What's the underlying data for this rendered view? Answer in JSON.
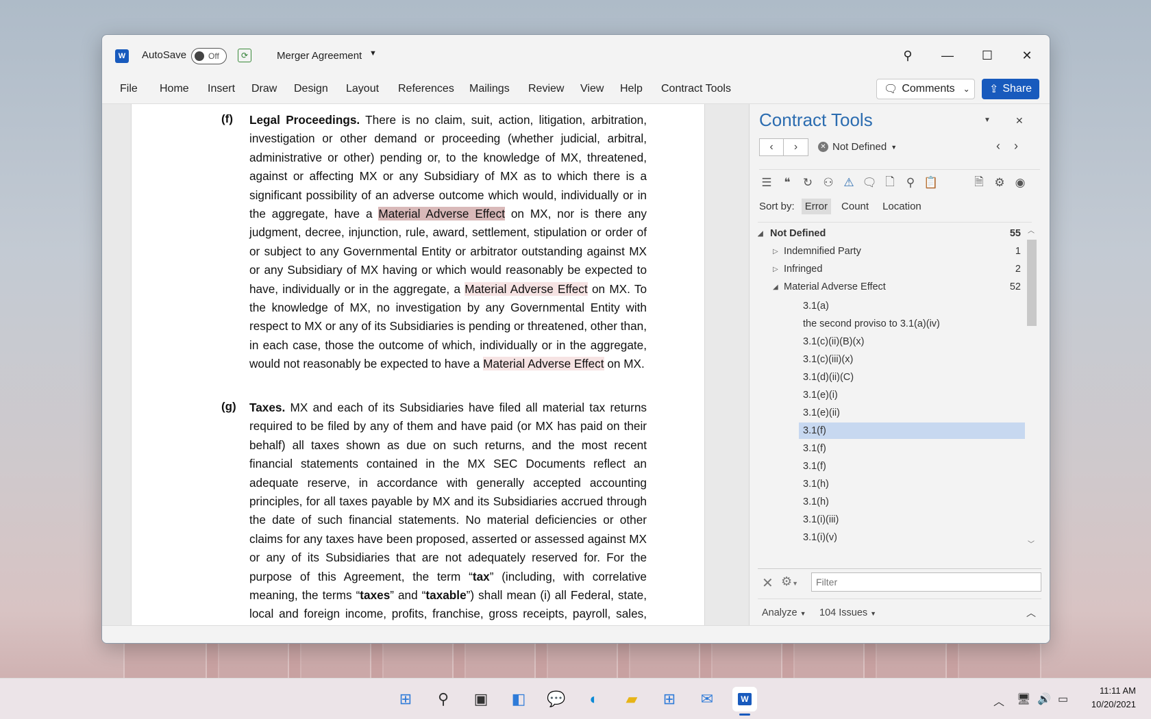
{
  "window": {
    "app_icon": "word-icon",
    "autosave_label": "AutoSave",
    "autosave_state": "Off",
    "document_title": "Merger Agreement"
  },
  "menu": [
    "File",
    "Home",
    "Insert",
    "Draw",
    "Design",
    "Layout",
    "References",
    "Mailings",
    "Review",
    "View",
    "Help",
    "Contract Tools"
  ],
  "ribbon_right": {
    "comments_label": "Comments",
    "share_label": "Share"
  },
  "document": {
    "para_f": {
      "num": "(f)",
      "heading": "Legal Proceedings.",
      "text_1": " There is no claim, suit, action, litigation, arbitration, investigation or other demand or proceeding (whether judicial, arbitral, administrative or other) pending or, to the knowledge of MX, threatened, against or affecting MX or any Subsidiary of MX as to which there is a significant possibility of an adverse outcome which would, individually or in the aggregate, have a ",
      "hl_1": "Material Adverse Effect",
      "text_2": " on MX, nor is there any judgment, decree, injunction, rule, award, settlement, stipulation or order of or subject to any Governmental Entity or arbitrator outstanding against MX or any Subsidiary of MX having or which would reasonably be expected to have, individually or in the aggregate, a ",
      "hl_2": "Material Adverse Effect",
      "text_3": " on MX. To the knowledge of MX, no investigation by any Governmental Entity with respect to MX or any of its Subsidiaries is pending or threatened, other than, in each case, those the outcome of which, individually or in the aggregate, would not reasonably be expected to have a ",
      "hl_3": "Material Adverse Effect",
      "text_4": " on MX."
    },
    "para_g": {
      "num": "(g)",
      "heading": "Taxes.",
      "text_1": " MX and each of its Subsidiaries have filed all material tax returns required to be filed by any of them and have paid (or MX has paid on their behalf) all taxes shown as due on such returns, and the most recent financial statements contained in the MX SEC Documents reflect an adequate reserve, in accordance with generally accepted accounting principles, for all taxes payable by MX and its Subsidiaries accrued through the date of such financial statements. No material deficiencies or other claims for any taxes have been proposed, asserted or assessed against MX or any of its Subsidiaries that are not adequately reserved for. For the purpose of this Agreement, the term “",
      "term_1": "tax",
      "text_2": "” (including, with correlative meaning, the terms “",
      "term_2": "taxes",
      "text_3": "” and “",
      "term_3": "taxable",
      "text_4": "”) shall mean (i) all Federal, state, local and foreign income, profits, franchise, gross receipts, payroll, sales, employment, use,"
    }
  },
  "pane": {
    "title": "Contract Tools",
    "filter_value": "Not Defined",
    "sort_label": "Sort by:",
    "sort_options": [
      "Error",
      "Count",
      "Location"
    ],
    "sort_active": "Error",
    "tree": {
      "group": {
        "label": "Not Defined",
        "count": "55"
      },
      "children": [
        {
          "label": "Indemnified Party",
          "count": "1",
          "expanded": false
        },
        {
          "label": "Infringed",
          "count": "2",
          "expanded": false
        },
        {
          "label": "Material Adverse Effect",
          "count": "52",
          "expanded": true
        }
      ],
      "locations": [
        "3.1(a)",
        "the second proviso to 3.1(a)(iv)",
        "3.1(c)(ii)(B)(x)",
        "3.1(c)(iii)(x)",
        "3.1(d)(ii)(C)",
        "3.1(e)(i)",
        "3.1(e)(ii)",
        "3.1(f)",
        "3.1(f)",
        "3.1(f)",
        "3.1(h)",
        "3.1(h)",
        "3.1(i)(iii)",
        "3.1(i)(v)"
      ],
      "selected_index": 7
    },
    "filter_placeholder": "Filter",
    "analyze_label": "Analyze",
    "issues_label": "104 Issues"
  },
  "taskbar": {
    "icons": [
      "windows-start-icon",
      "search-icon",
      "task-view-icon",
      "widgets-icon",
      "teams-chat-icon",
      "edge-icon",
      "file-explorer-icon",
      "store-icon",
      "mail-icon",
      "word-icon"
    ],
    "time": "11:11 AM",
    "date": "10/20/2021"
  },
  "colors": {
    "accent": "#185abd",
    "pane_title": "#2b6cb0",
    "highlight_strong": "#d9b9b9",
    "highlight_soft": "#f6e3e3",
    "selected_row": "#c7d8f0"
  }
}
